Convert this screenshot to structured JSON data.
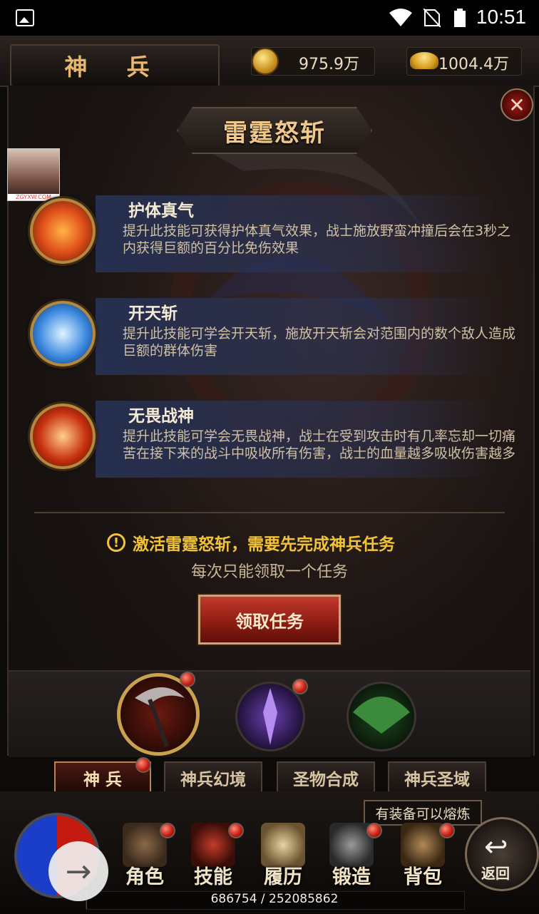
{
  "status_bar": {
    "time": "10:51"
  },
  "header": {
    "title": "神 兵",
    "gold": "975.9万",
    "ingot": "1004.4万"
  },
  "skill_panel": {
    "title": "雷霆怒斩",
    "watermark": "ZGYXW.COM",
    "skills": [
      {
        "name": "护体真气",
        "desc": "提升此技能可获得护体真气效果，战士施放野蛮冲撞后会在3秒之内获得巨额的百分比免伤效果",
        "icon": "running-figure-icon",
        "color": "#e0501a"
      },
      {
        "name": "开天斩",
        "desc": "提升此技能可学会开天斩，施放开天斩会对范围内的数个敌人造成巨额的群体伤害",
        "icon": "blade-icon",
        "color": "#3d8ae0"
      },
      {
        "name": "无畏战神",
        "desc": "提升此技能可学会无畏战神，战士在受到攻击时有几率忘却一切痛苦在接下来的战斗中吸收所有伤害，战士的血量越多吸收伤害越多",
        "icon": "warrior-icon",
        "color": "#c8320f"
      }
    ],
    "warning": "激活雷霆怒斩，需要先完成神兵任务",
    "note": "每次只能领取一个任务",
    "accept_button": "领取任务"
  },
  "weapons": [
    {
      "name": "scythe-weapon-icon",
      "selected": true,
      "alert": true
    },
    {
      "name": "purple-staff-weapon-icon",
      "selected": false,
      "alert": true
    },
    {
      "name": "green-fan-weapon-icon",
      "selected": false,
      "alert": false
    }
  ],
  "tabs": [
    {
      "label": "神 兵",
      "active": true,
      "alert": true
    },
    {
      "label": "神兵幻境",
      "active": false,
      "alert": false
    },
    {
      "label": "圣物合成",
      "active": false,
      "alert": false
    },
    {
      "label": "神兵圣域",
      "active": false,
      "alert": false
    }
  ],
  "bottom_nav": {
    "tip": "有装备可以熔炼",
    "items": [
      {
        "label": "角色",
        "icon": "helmet-icon"
      },
      {
        "label": "技能",
        "icon": "skill-book-icon"
      },
      {
        "label": "履历",
        "icon": "scroll-icon"
      },
      {
        "label": "锻造",
        "icon": "hammer-icon"
      },
      {
        "label": "背包",
        "icon": "bag-icon"
      }
    ],
    "back_label": "返回",
    "exp_text": "686754 / 252085862",
    "exp_fraction": 0.0027
  }
}
